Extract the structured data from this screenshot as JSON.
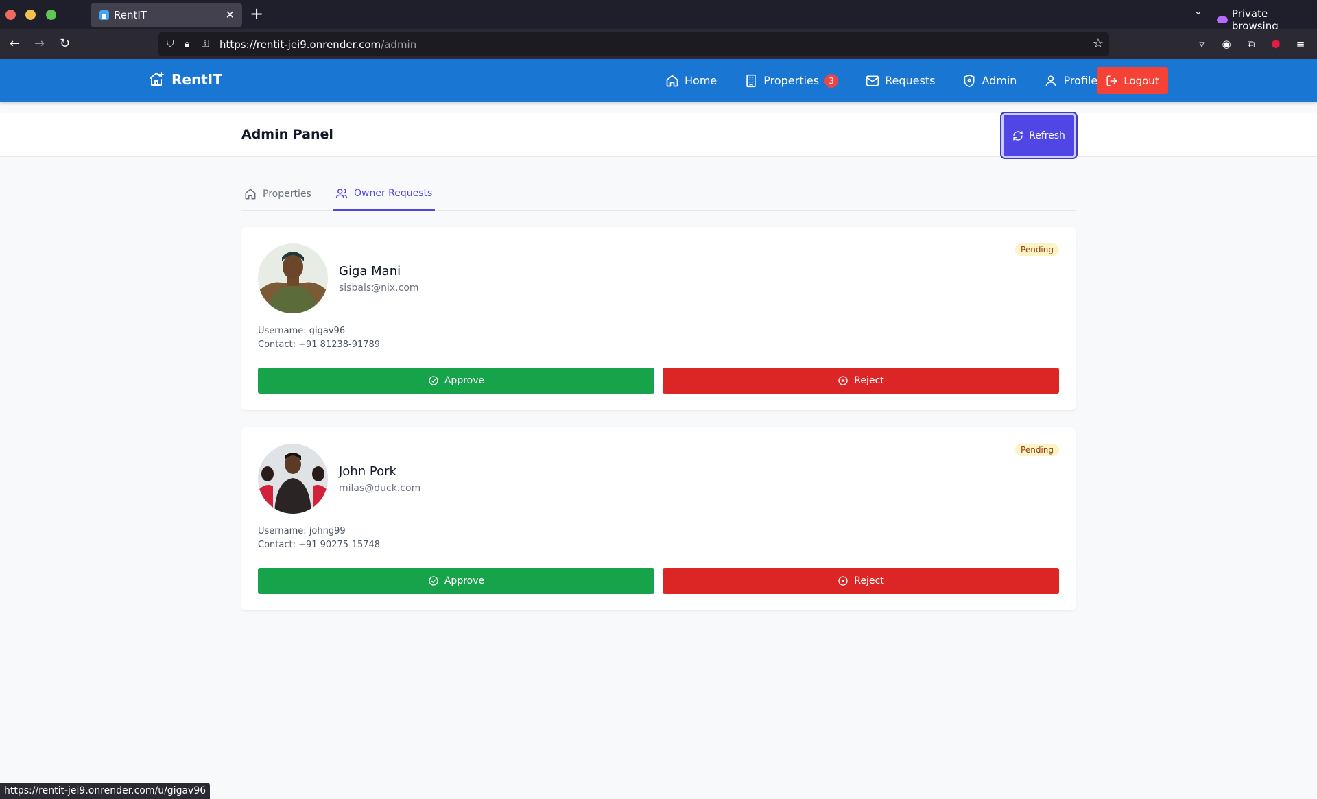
{
  "browser": {
    "tab_title": "RentIT",
    "url_domain": "https://rentit-jei9.onrender.com",
    "url_path": "/admin",
    "private_label": "Private browsing",
    "status_url": "https://rentit-jei9.onrender.com/u/gigav96"
  },
  "app": {
    "brand": "RentIT",
    "nav": [
      {
        "label": "Home",
        "icon": "home-icon"
      },
      {
        "label": "Properties",
        "icon": "building-icon",
        "badge": "3"
      },
      {
        "label": "Requests",
        "icon": "mail-icon"
      },
      {
        "label": "Admin",
        "icon": "shield-icon"
      },
      {
        "label": "Profile",
        "icon": "user-icon"
      }
    ],
    "logout_label": "Logout"
  },
  "page": {
    "title": "Admin Panel",
    "refresh_label": "Refresh",
    "tabs": [
      {
        "label": "Properties",
        "active": false
      },
      {
        "label": "Owner Requests",
        "active": true
      }
    ]
  },
  "requests": [
    {
      "name": "Giga Mani",
      "email": "sisbals@nix.com",
      "status": "Pending",
      "username": "Username: gigav96",
      "contact": "Contact: +91 81238-91789",
      "approve_label": "Approve",
      "reject_label": "Reject"
    },
    {
      "name": "John Pork",
      "email": "milas@duck.com",
      "status": "Pending",
      "username": "Username: johng99",
      "contact": "Contact: +91 90275-15748",
      "approve_label": "Approve",
      "reject_label": "Reject"
    }
  ],
  "colors": {
    "primary": "#1976d2",
    "accent": "#4f46e5",
    "approve": "#16a34a",
    "reject": "#dc2626",
    "logout": "#f44336"
  }
}
